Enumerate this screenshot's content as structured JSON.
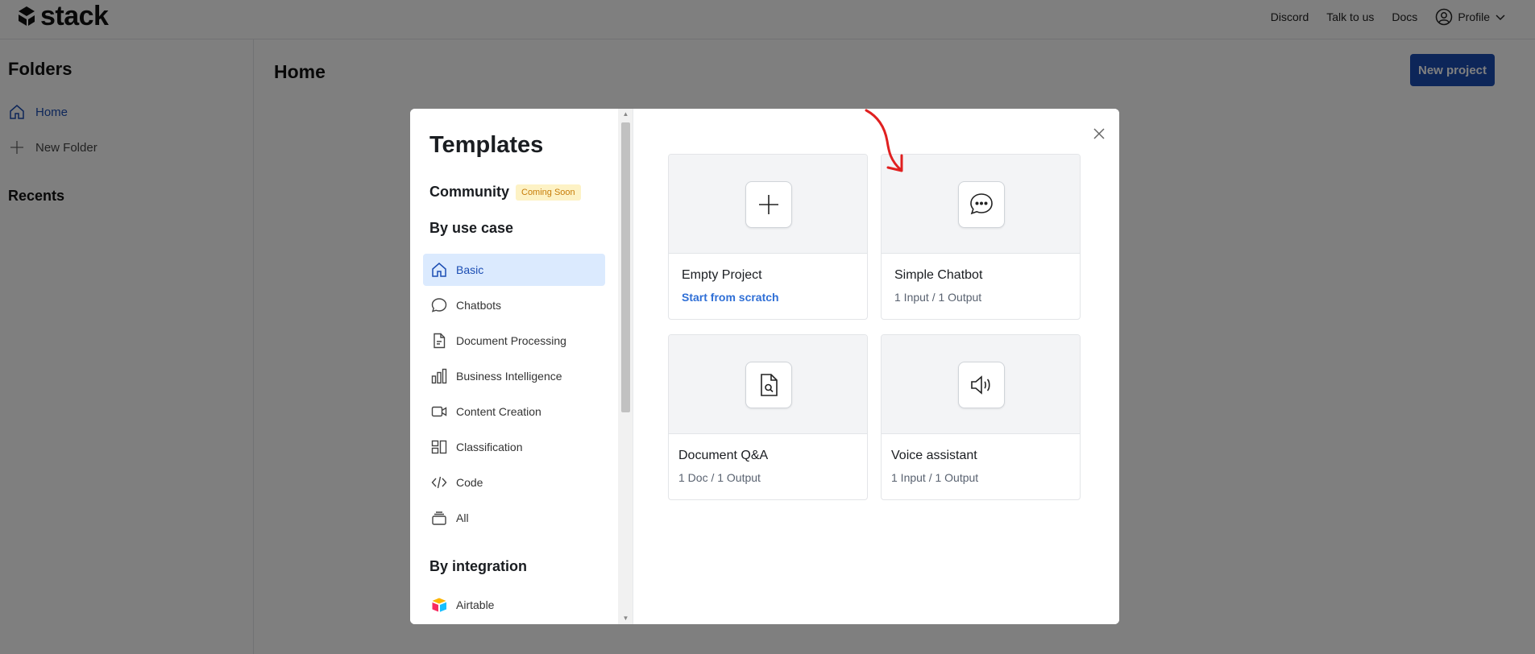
{
  "app": {
    "logo_text": "stack"
  },
  "topnav": {
    "discord": "Discord",
    "talk": "Talk to us",
    "docs": "Docs",
    "profile": "Profile"
  },
  "sidebar": {
    "title": "Folders",
    "home": "Home",
    "new_folder": "New Folder",
    "recents": "Recents"
  },
  "main": {
    "title": "Home",
    "new_project": "New project"
  },
  "modal": {
    "title": "Templates",
    "community": "Community",
    "coming_soon": "Coming Soon",
    "by_use_case": "By use case",
    "categories": [
      "Basic",
      "Chatbots",
      "Document Processing",
      "Business Intelligence",
      "Content Creation",
      "Classification",
      "Code",
      "All"
    ],
    "by_integration": "By integration",
    "integrations": [
      "Airtable"
    ],
    "cards": [
      {
        "name": "Empty Project",
        "sub": "Start from scratch",
        "icon": "plus-icon"
      },
      {
        "name": "Simple Chatbot",
        "sub": "1 Input / 1 Output",
        "icon": "chat-bubble-icon"
      },
      {
        "name": "Document Q&A",
        "sub": "1 Doc / 1 Output",
        "icon": "document-search-icon"
      },
      {
        "name": "Voice assistant",
        "sub": "1 Input / 1 Output",
        "icon": "speaker-icon"
      }
    ]
  },
  "colors": {
    "accent": "#1b4db3",
    "link": "#2f6fd6",
    "badge_bg": "#fdf2c5",
    "badge_text": "#c77c08",
    "annotation": "#e02020"
  }
}
